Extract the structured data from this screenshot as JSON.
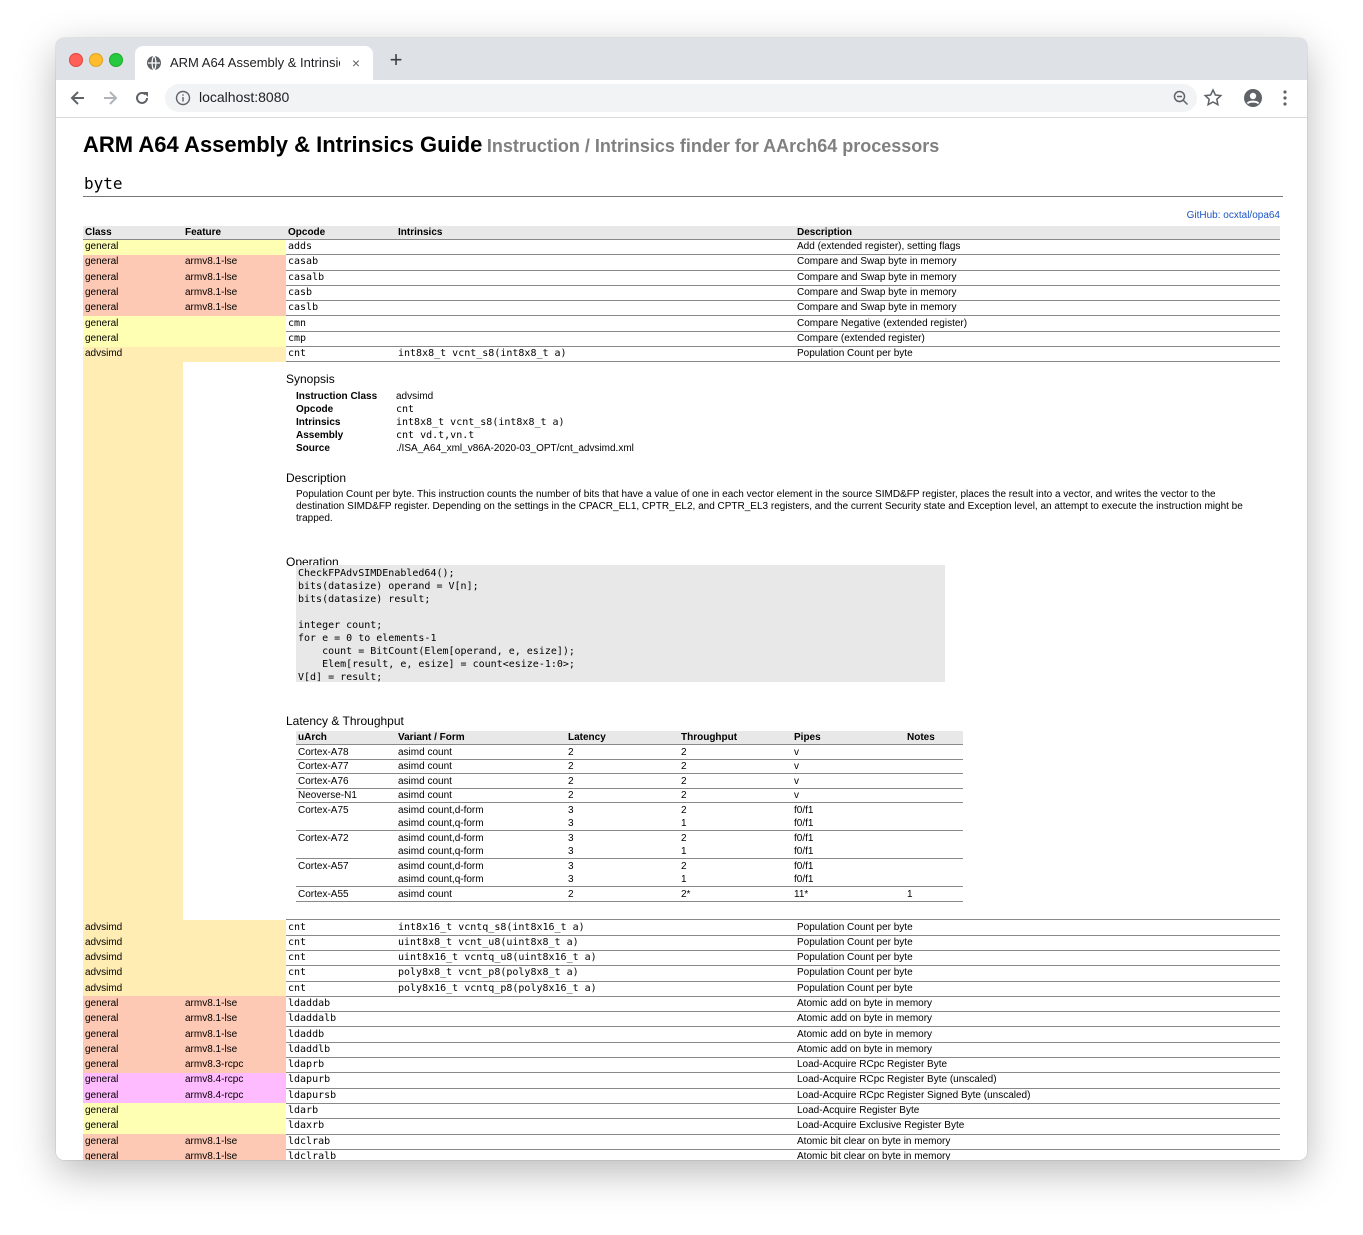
{
  "browser": {
    "tab_title": "ARM A64 Assembly & Intrinsics Guide",
    "tab_close": "×",
    "new_tab": "+",
    "url": "localhost:8080"
  },
  "page": {
    "title": "ARM A64 Assembly & Intrinsics Guide",
    "subtitle": "Instruction / Intrinsics finder for AArch64 processors",
    "search_value": "byte",
    "github_link": "GitHub: ocxtal/opa64",
    "columns": [
      "Class",
      "Feature",
      "Opcode",
      "Intrinsics",
      "Description"
    ]
  },
  "rows_before": [
    {
      "cls": "general",
      "feature": "",
      "opcode": "adds",
      "intrinsic": "",
      "desc": "Add (extended register), setting flags",
      "kind": "general"
    },
    {
      "cls": "general",
      "feature": "armv8.1-lse",
      "opcode": "casab",
      "intrinsic": "",
      "desc": "Compare and Swap byte in memory",
      "kind": "lse"
    },
    {
      "cls": "general",
      "feature": "armv8.1-lse",
      "opcode": "casalb",
      "intrinsic": "",
      "desc": "Compare and Swap byte in memory",
      "kind": "lse"
    },
    {
      "cls": "general",
      "feature": "armv8.1-lse",
      "opcode": "casb",
      "intrinsic": "",
      "desc": "Compare and Swap byte in memory",
      "kind": "lse"
    },
    {
      "cls": "general",
      "feature": "armv8.1-lse",
      "opcode": "caslb",
      "intrinsic": "",
      "desc": "Compare and Swap byte in memory",
      "kind": "lse"
    },
    {
      "cls": "general",
      "feature": "",
      "opcode": "cmn",
      "intrinsic": "",
      "desc": "Compare Negative (extended register)",
      "kind": "general"
    },
    {
      "cls": "general",
      "feature": "",
      "opcode": "cmp",
      "intrinsic": "",
      "desc": "Compare (extended register)",
      "kind": "general"
    },
    {
      "cls": "advsimd",
      "feature": "",
      "opcode": "cnt",
      "intrinsic": "int8x8_t vcnt_s8(int8x8_t a)",
      "desc": "Population Count per byte",
      "kind": "advsimd"
    }
  ],
  "detail": {
    "synopsis_heading": "Synopsis",
    "synopsis": [
      {
        "k": "Instruction Class",
        "v": "advsimd",
        "mono": false
      },
      {
        "k": "Opcode",
        "v": "cnt",
        "mono": true
      },
      {
        "k": "Intrinsics",
        "v": "int8x8_t vcnt_s8(int8x8_t a)",
        "mono": true
      },
      {
        "k": "Assembly",
        "v": "cnt vd.t,vn.t",
        "mono": true
      },
      {
        "k": "Source",
        "v": "./ISA_A64_xml_v86A-2020-03_OPT/cnt_advsimd.xml",
        "mono": false
      }
    ],
    "description_heading": "Description",
    "description": "Population Count per byte. This instruction counts the number of bits that have a value of one in each vector element in the source SIMD&FP register, places the result into a vector, and writes the vector to the destination SIMD&FP register. Depending on the settings in the CPACR_EL1, CPTR_EL2, and CPTR_EL3 registers, and the current Security state and Exception level, an attempt to execute the instruction might be trapped.",
    "operation_heading": "Operation",
    "operation": "CheckFPAdvSIMDEnabled64();\nbits(datasize) operand = V[n];\nbits(datasize) result;\n\ninteger count;\nfor e = 0 to elements-1\n    count = BitCount(Elem[operand, e, esize]);\n    Elem[result, e, esize] = count<esize-1:0>;\nV[d] = result;",
    "latency_heading": "Latency & Throughput",
    "latency_columns": [
      "uArch",
      "Variant / Form",
      "Latency",
      "Throughput",
      "Pipes",
      "Notes"
    ],
    "latency_rows": [
      {
        "uarch": "Cortex-A78",
        "variant": "asimd count",
        "lat": "2",
        "thr": "2",
        "pipes": "v",
        "notes": "",
        "line": true
      },
      {
        "uarch": "Cortex-A77",
        "variant": "asimd count",
        "lat": "2",
        "thr": "2",
        "pipes": "v",
        "notes": "",
        "line": true
      },
      {
        "uarch": "Cortex-A76",
        "variant": "asimd count",
        "lat": "2",
        "thr": "2",
        "pipes": "v",
        "notes": "",
        "line": true
      },
      {
        "uarch": "Neoverse-N1",
        "variant": "asimd count",
        "lat": "2",
        "thr": "2",
        "pipes": "v",
        "notes": "",
        "line": true
      },
      {
        "uarch": "Cortex-A75",
        "variant": "asimd count,d-form",
        "lat": "3",
        "thr": "2",
        "pipes": "f0/f1",
        "notes": "",
        "line": false
      },
      {
        "uarch": "",
        "variant": "asimd count,q-form",
        "lat": "3",
        "thr": "1",
        "pipes": "f0/f1",
        "notes": "",
        "line": true
      },
      {
        "uarch": "Cortex-A72",
        "variant": "asimd count,d-form",
        "lat": "3",
        "thr": "2",
        "pipes": "f0/f1",
        "notes": "",
        "line": false
      },
      {
        "uarch": "",
        "variant": "asimd count,q-form",
        "lat": "3",
        "thr": "1",
        "pipes": "f0/f1",
        "notes": "",
        "line": true
      },
      {
        "uarch": "Cortex-A57",
        "variant": "asimd count,d-form",
        "lat": "3",
        "thr": "2",
        "pipes": "f0/f1",
        "notes": "",
        "line": false
      },
      {
        "uarch": "",
        "variant": "asimd count,q-form",
        "lat": "3",
        "thr": "1",
        "pipes": "f0/f1",
        "notes": "",
        "line": true
      },
      {
        "uarch": "Cortex-A55",
        "variant": "asimd count",
        "lat": "2",
        "thr": "2*",
        "pipes": "11*",
        "notes": "1",
        "line": true
      }
    ]
  },
  "rows_after": [
    {
      "cls": "advsimd",
      "feature": "",
      "opcode": "cnt",
      "intrinsic": "int8x16_t vcntq_s8(int8x16_t a)",
      "desc": "Population Count per byte",
      "kind": "advsimd"
    },
    {
      "cls": "advsimd",
      "feature": "",
      "opcode": "cnt",
      "intrinsic": "uint8x8_t vcnt_u8(uint8x8_t a)",
      "desc": "Population Count per byte",
      "kind": "advsimd"
    },
    {
      "cls": "advsimd",
      "feature": "",
      "opcode": "cnt",
      "intrinsic": "uint8x16_t vcntq_u8(uint8x16_t a)",
      "desc": "Population Count per byte",
      "kind": "advsimd"
    },
    {
      "cls": "advsimd",
      "feature": "",
      "opcode": "cnt",
      "intrinsic": "poly8x8_t vcnt_p8(poly8x8_t a)",
      "desc": "Population Count per byte",
      "kind": "advsimd"
    },
    {
      "cls": "advsimd",
      "feature": "",
      "opcode": "cnt",
      "intrinsic": "poly8x16_t vcntq_p8(poly8x16_t a)",
      "desc": "Population Count per byte",
      "kind": "advsimd"
    },
    {
      "cls": "general",
      "feature": "armv8.1-lse",
      "opcode": "ldaddab",
      "intrinsic": "",
      "desc": "Atomic add on byte in memory",
      "kind": "lse"
    },
    {
      "cls": "general",
      "feature": "armv8.1-lse",
      "opcode": "ldaddalb",
      "intrinsic": "",
      "desc": "Atomic add on byte in memory",
      "kind": "lse"
    },
    {
      "cls": "general",
      "feature": "armv8.1-lse",
      "opcode": "ldaddb",
      "intrinsic": "",
      "desc": "Atomic add on byte in memory",
      "kind": "lse"
    },
    {
      "cls": "general",
      "feature": "armv8.1-lse",
      "opcode": "ldaddlb",
      "intrinsic": "",
      "desc": "Atomic add on byte in memory",
      "kind": "lse"
    },
    {
      "cls": "general",
      "feature": "armv8.3-rcpc",
      "opcode": "ldaprb",
      "intrinsic": "",
      "desc": "Load-Acquire RCpc Register Byte",
      "kind": "lse"
    },
    {
      "cls": "general",
      "feature": "armv8.4-rcpc",
      "opcode": "ldapurb",
      "intrinsic": "",
      "desc": "Load-Acquire RCpc Register Byte (unscaled)",
      "kind": "rcpc"
    },
    {
      "cls": "general",
      "feature": "armv8.4-rcpc",
      "opcode": "ldapursb",
      "intrinsic": "",
      "desc": "Load-Acquire RCpc Register Signed Byte (unscaled)",
      "kind": "rcpc"
    },
    {
      "cls": "general",
      "feature": "",
      "opcode": "ldarb",
      "intrinsic": "",
      "desc": "Load-Acquire Register Byte",
      "kind": "general"
    },
    {
      "cls": "general",
      "feature": "",
      "opcode": "ldaxrb",
      "intrinsic": "",
      "desc": "Load-Acquire Exclusive Register Byte",
      "kind": "general"
    },
    {
      "cls": "general",
      "feature": "armv8.1-lse",
      "opcode": "ldclrab",
      "intrinsic": "",
      "desc": "Atomic bit clear on byte in memory",
      "kind": "lse"
    },
    {
      "cls": "general",
      "feature": "armv8.1-lse",
      "opcode": "ldclralb",
      "intrinsic": "",
      "desc": "Atomic bit clear on byte in memory",
      "kind": "lse"
    }
  ]
}
